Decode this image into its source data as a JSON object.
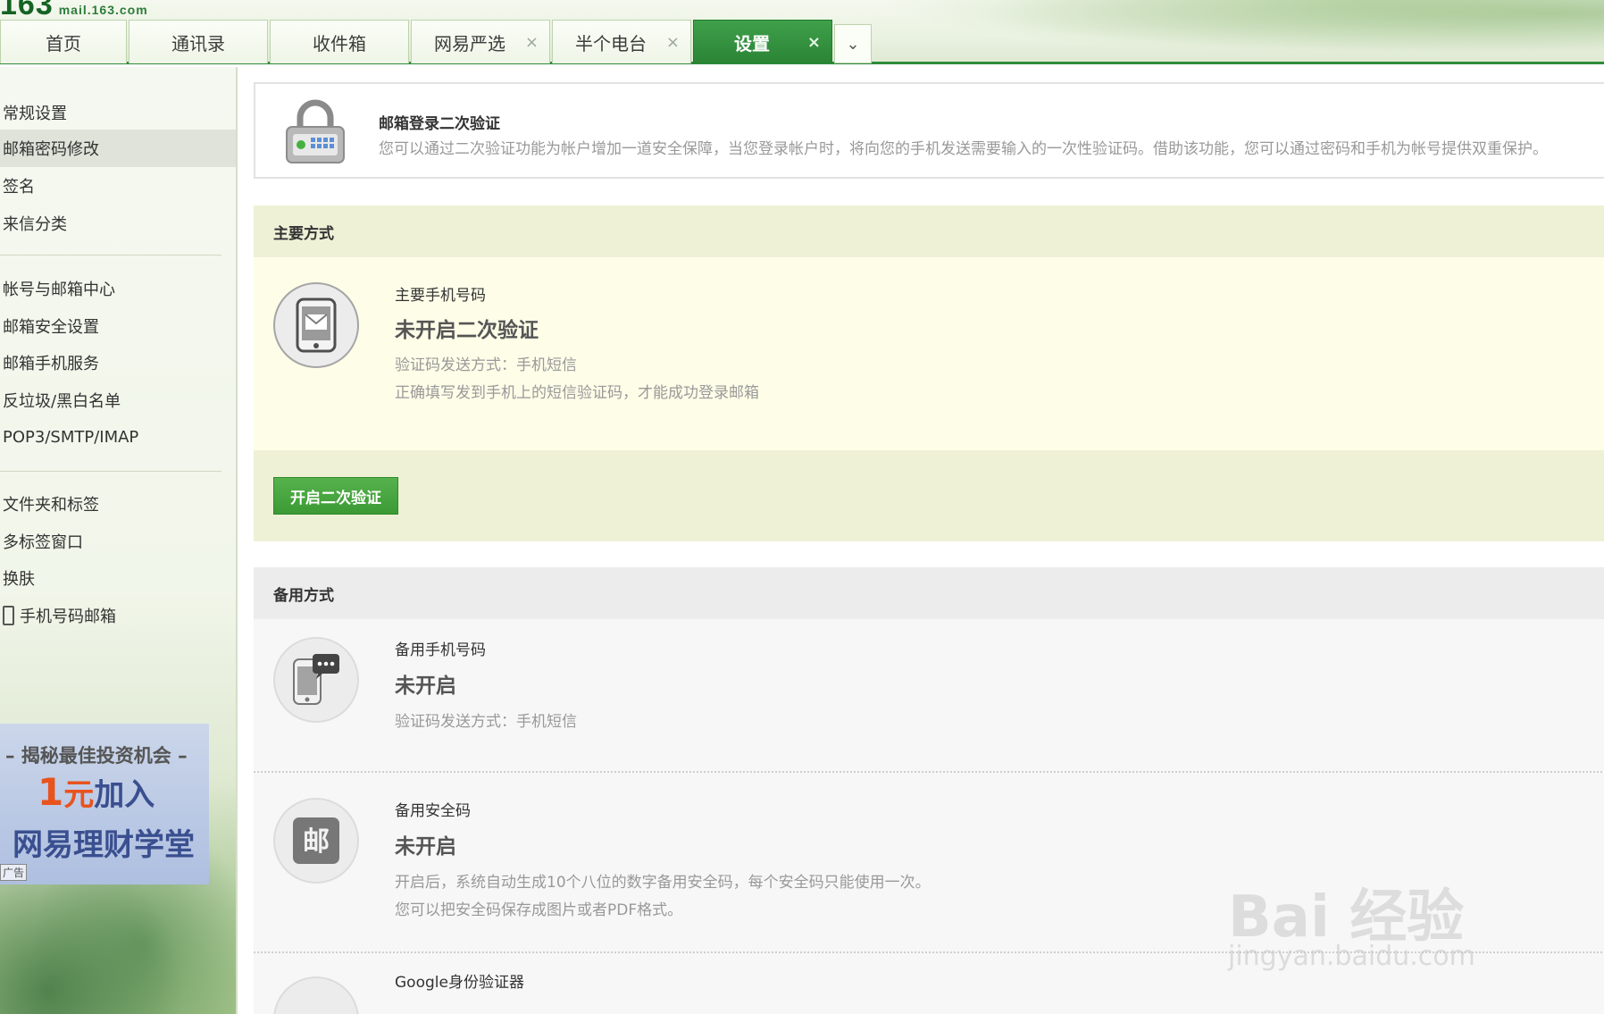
{
  "header": {
    "logo_big": "163",
    "logo_small": "mail.163.com",
    "tabs": [
      {
        "label": "首页",
        "closable": false
      },
      {
        "label": "通讯录",
        "closable": false
      },
      {
        "label": "收件箱",
        "closable": false
      },
      {
        "label": "网易严选",
        "closable": true
      },
      {
        "label": "半个电台",
        "closable": true
      },
      {
        "label": "设置",
        "closable": true,
        "active": true
      }
    ],
    "close_glyph": "×",
    "more_glyph": "⌄"
  },
  "sidebar": {
    "group1": [
      "常规设置",
      "邮箱密码修改",
      "签名",
      "来信分类"
    ],
    "group2": [
      "帐号与邮箱中心",
      "邮箱安全设置",
      "邮箱手机服务",
      "反垃圾/黑白名单",
      "POP3/SMTP/IMAP"
    ],
    "group3": [
      "文件夹和标签",
      "多标签窗口",
      "换肤",
      "手机号码邮箱"
    ],
    "selected": "邮箱密码修改",
    "ad": {
      "line1": "– 揭秘最佳投资机会 –",
      "line2_num": "1",
      "line2_unit": "元",
      "line2_rest": "加入",
      "line3": "网易理财学堂",
      "tag": "广告"
    }
  },
  "intro": {
    "title": "邮箱登录二次验证",
    "desc": "您可以通过二次验证功能为帐户增加一道安全保障，当您登录帐户时，将向您的手机发送需要输入的一次性验证码。借助该功能，您可以通过密码和手机为帐号提供双重保护。"
  },
  "primary": {
    "heading": "主要方式",
    "label": "主要手机号码",
    "status": "未开启二次验证",
    "note1": "验证码发送方式：手机短信",
    "note2": "正确填写发到手机上的短信验证码，才能成功登录邮箱",
    "button": "开启二次验证"
  },
  "backup": {
    "heading": "备用方式",
    "items": [
      {
        "label": "备用手机号码",
        "status": "未开启",
        "note1": "验证码发送方式：手机短信",
        "note2": ""
      },
      {
        "label": "备用安全码",
        "status": "未开启",
        "note1": "开启后，系统自动生成10个八位的数字备用安全码，每个安全码只能使用一次。",
        "note2": "您可以把安全码保存成图片或者PDF格式。"
      },
      {
        "label": "Google身份验证器",
        "status": "",
        "note1": "",
        "note2": ""
      }
    ]
  },
  "watermark": {
    "text": "Bai 经验",
    "url": "jingyan.baidu.com"
  },
  "colors": {
    "accent": "#2f8b3a",
    "button": "#3c9a35",
    "primary_bg": "#fdfde8",
    "head_bg": "#eef1d6"
  }
}
